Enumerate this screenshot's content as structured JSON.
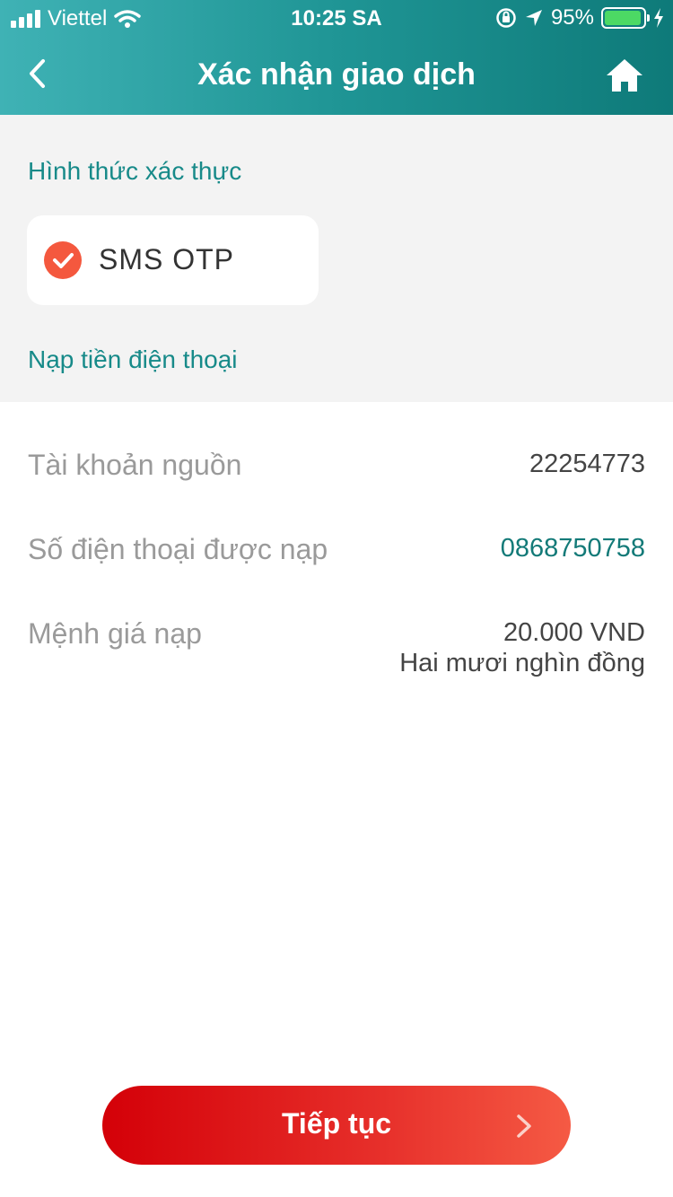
{
  "status_bar": {
    "carrier": "Viettel",
    "time": "10:25 SA",
    "battery": "95%",
    "battery_level": 0.95
  },
  "header": {
    "title": "Xác nhận giao dịch",
    "back_icon": "chevron-left-icon",
    "home_icon": "home-icon"
  },
  "auth": {
    "section_title": "Hình thức xác thực",
    "selected_method": "SMS OTP",
    "check_icon": "check-circle-icon"
  },
  "transaction": {
    "section_title": "Nạp tiền điện thoại",
    "rows": [
      {
        "label": "Tài khoản nguồn",
        "value": "22254773"
      },
      {
        "label": "Số điện thoại được nạp",
        "value": "0868750758"
      },
      {
        "label": "Mệnh giá nạp",
        "value": "20.000 VND",
        "subvalue": "Hai mươi nghìn đồng"
      }
    ]
  },
  "footer": {
    "continue_label": "Tiếp tục",
    "arrow_icon": "chevron-right-icon"
  },
  "colors": {
    "header_start": "#3fb2b5",
    "header_end": "#0e7a79",
    "accent_teal": "#178a89",
    "button_red": "#d40008",
    "check_orange": "#f4583e"
  }
}
